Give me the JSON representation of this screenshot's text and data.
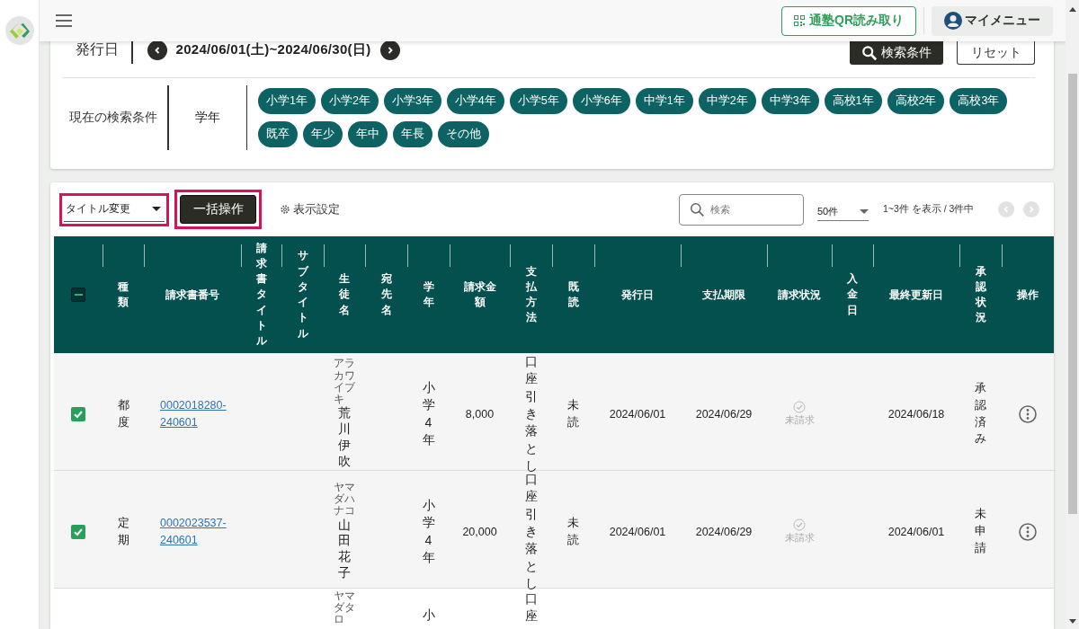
{
  "header": {
    "qr_button": "通塾QR読み取り",
    "my_menu": "マイメニュー"
  },
  "filter": {
    "date_label": "発行日",
    "date_range": "2024/06/01(土)~2024/06/30(日)",
    "search_button": "検索条件",
    "reset_button": "リセット",
    "conditions_label": "現在の検索条件",
    "condition_name": "学年",
    "chips": [
      "小学1年",
      "小学2年",
      "小学3年",
      "小学4年",
      "小学5年",
      "小学6年",
      "中学1年",
      "中学2年",
      "中学3年",
      "高校1年",
      "高校2年",
      "高校3年",
      "既卒",
      "年少",
      "年中",
      "年長",
      "その他"
    ]
  },
  "toolbar": {
    "action_select": "タイトル変更",
    "bulk_button": "一括操作",
    "display_settings": "表示設定",
    "search_placeholder": "検索",
    "per_page": "50件",
    "range_text": "1~3件 を表示 / 3件中",
    "prev_disabled": true,
    "next_disabled": true
  },
  "table": {
    "header_checkbox": {
      "indeterminate": true
    },
    "columns": [
      {
        "label": "種類",
        "vertical": true
      },
      {
        "label": "請求書番号",
        "vertical": false
      },
      {
        "label": "請求書タイトル",
        "vertical": true
      },
      {
        "label": "サブタイトル",
        "vertical": true
      },
      {
        "label": "生徒名",
        "vertical": true
      },
      {
        "label": "宛先名",
        "vertical": true
      },
      {
        "label": "学年",
        "vertical": true
      },
      {
        "label": "請求金額",
        "vertical": false
      },
      {
        "label": "支払方法",
        "vertical": true
      },
      {
        "label": "既読",
        "vertical": true
      },
      {
        "label": "発行日",
        "vertical": false
      },
      {
        "label": "支払期限",
        "vertical": false
      },
      {
        "label": "請求状況",
        "vertical": false
      },
      {
        "label": "入金日",
        "vertical": true
      },
      {
        "label": "最終更新日",
        "vertical": false
      },
      {
        "label": "承認状況",
        "vertical": true
      },
      {
        "label": "操作",
        "vertical": false
      }
    ],
    "rows": [
      {
        "checked": true,
        "type": "都度",
        "invoice_no": "0002018280-240601",
        "student_kana": "アラカワイブキ",
        "student_name": "荒川伊吹",
        "grade": "小学4年",
        "amount": "8,000",
        "payment_method": "口座引き落とし",
        "read_status": "未読",
        "issue_date": "2024/06/01",
        "due_date": "2024/06/29",
        "billing_status": "未請求",
        "last_updated": "2024/06/18",
        "approval_status": "承認済み",
        "menu": true
      },
      {
        "checked": true,
        "type": "定期",
        "invoice_no": "0002023537-240601",
        "student_kana": "ヤマダハナコ",
        "student_name": "山田花子",
        "grade": "小学4年",
        "amount": "20,000",
        "payment_method": "口座引き落とし",
        "read_status": "未読",
        "issue_date": "2024/06/01",
        "due_date": "2024/06/29",
        "billing_status": "未請求",
        "last_updated": "2024/06/01",
        "approval_status": "未申請",
        "menu": true
      },
      {
        "cut_off": true,
        "student_kana": "ヤマダタロ",
        "grade": "小",
        "payment_method": "口座"
      }
    ]
  }
}
